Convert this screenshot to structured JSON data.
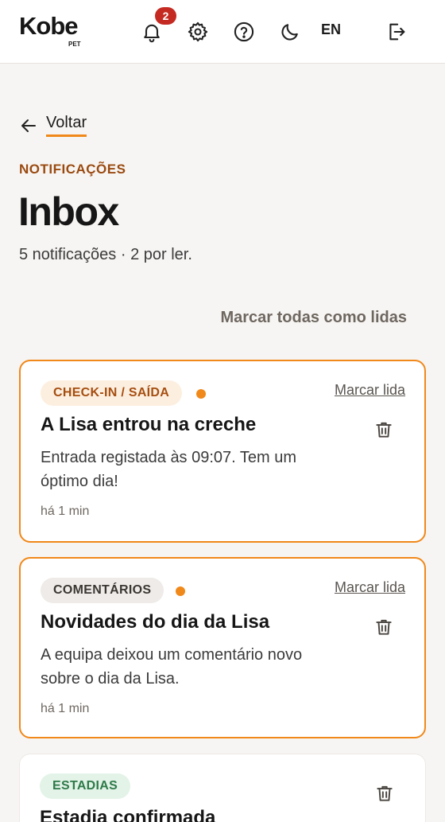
{
  "header": {
    "logo": "Kobe",
    "logo_sub": "PET",
    "notification_count": "2",
    "language": "EN",
    "icons": [
      "bell-icon",
      "gear-icon",
      "help-icon",
      "moon-icon",
      "logout-icon"
    ]
  },
  "back_label": "Voltar",
  "eyebrow": "NOTIFICAÇÕES",
  "title": "Inbox",
  "subtitle": "5 notificações · 2 por ler.",
  "mark_all_label": "Marcar todas como lidas",
  "colors": {
    "accent": "#f0881a",
    "eyebrow": "#9a4a10",
    "badge": "#c42a22"
  },
  "notifications": [
    {
      "tag": "CHECK-IN / SAÍDA",
      "tag_bg": "#fdefe0",
      "tag_color": "#a64e10",
      "unread": true,
      "mark_read_label": "Marcar lida",
      "title": "A Lisa entrou na creche",
      "body": "Entrada registada às 09:07. Tem um óptimo dia!",
      "time": "há 1 min"
    },
    {
      "tag": "COMENTÁRIOS",
      "tag_bg": "#eeebe8",
      "tag_color": "#3b3733",
      "unread": true,
      "mark_read_label": "Marcar lida",
      "title": "Novidades do dia da Lisa",
      "body": "A equipa deixou um comentário novo sobre o dia da Lisa.",
      "time": "há 1 min"
    },
    {
      "tag": "ESTADIAS",
      "tag_bg": "#e3f3e8",
      "tag_color": "#2e7a48",
      "unread": false,
      "title": "Estadia confirmada"
    }
  ]
}
